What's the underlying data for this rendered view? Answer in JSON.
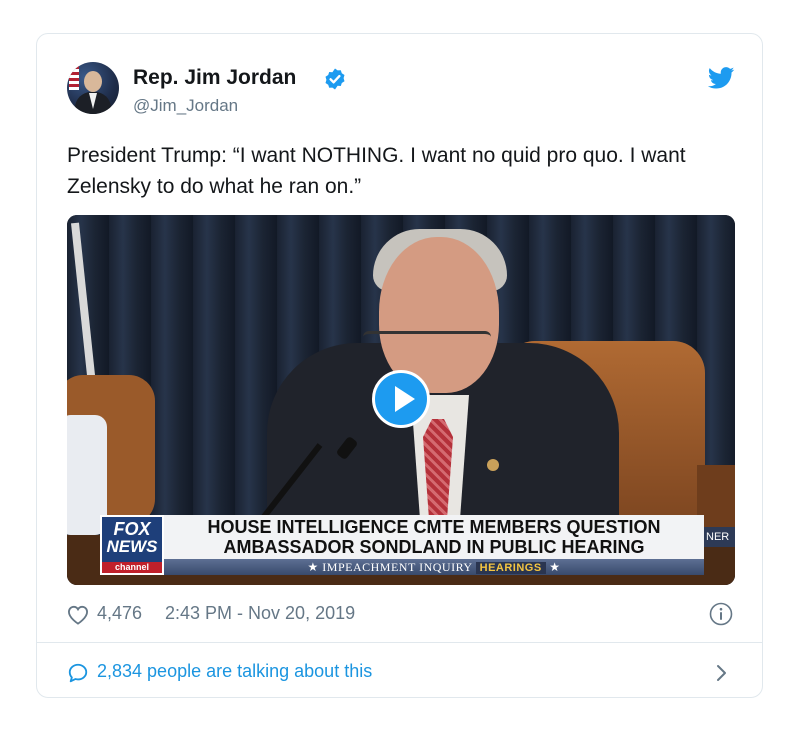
{
  "author": {
    "name": "Rep. Jim Jordan",
    "handle": "@Jim_Jordan"
  },
  "tweet": {
    "text": "President Trump: “I want NOTHING. I want no quid pro quo. I want Zelensky to do what he ran on.”"
  },
  "video": {
    "chyron_logo_line1": "FOX",
    "chyron_logo_line2": "NEWS",
    "chyron_logo_line3": "channel",
    "chyron_line1": "HOUSE INTELLIGENCE CMTE MEMBERS QUESTION",
    "chyron_line2": "AMBASSADOR SONDLAND IN PUBLIC HEARING",
    "chyron_sub": "IMPEACHMENT INQUIRY",
    "chyron_sub_highlight": "HEARINGS",
    "chyron_edge": "NER"
  },
  "footer": {
    "likes": "4,476",
    "timestamp": "2:43 PM - Nov 20, 2019",
    "talking": "2,834 people are talking about this"
  },
  "colors": {
    "twitter_blue": "#1d9bf0",
    "link_blue": "#1b95e0",
    "secondary_text": "#657786"
  },
  "icons": [
    "verified-badge-icon",
    "twitter-bird-icon",
    "play-icon",
    "heart-icon",
    "info-icon",
    "comment-bubble-icon",
    "chevron-right-icon"
  ]
}
